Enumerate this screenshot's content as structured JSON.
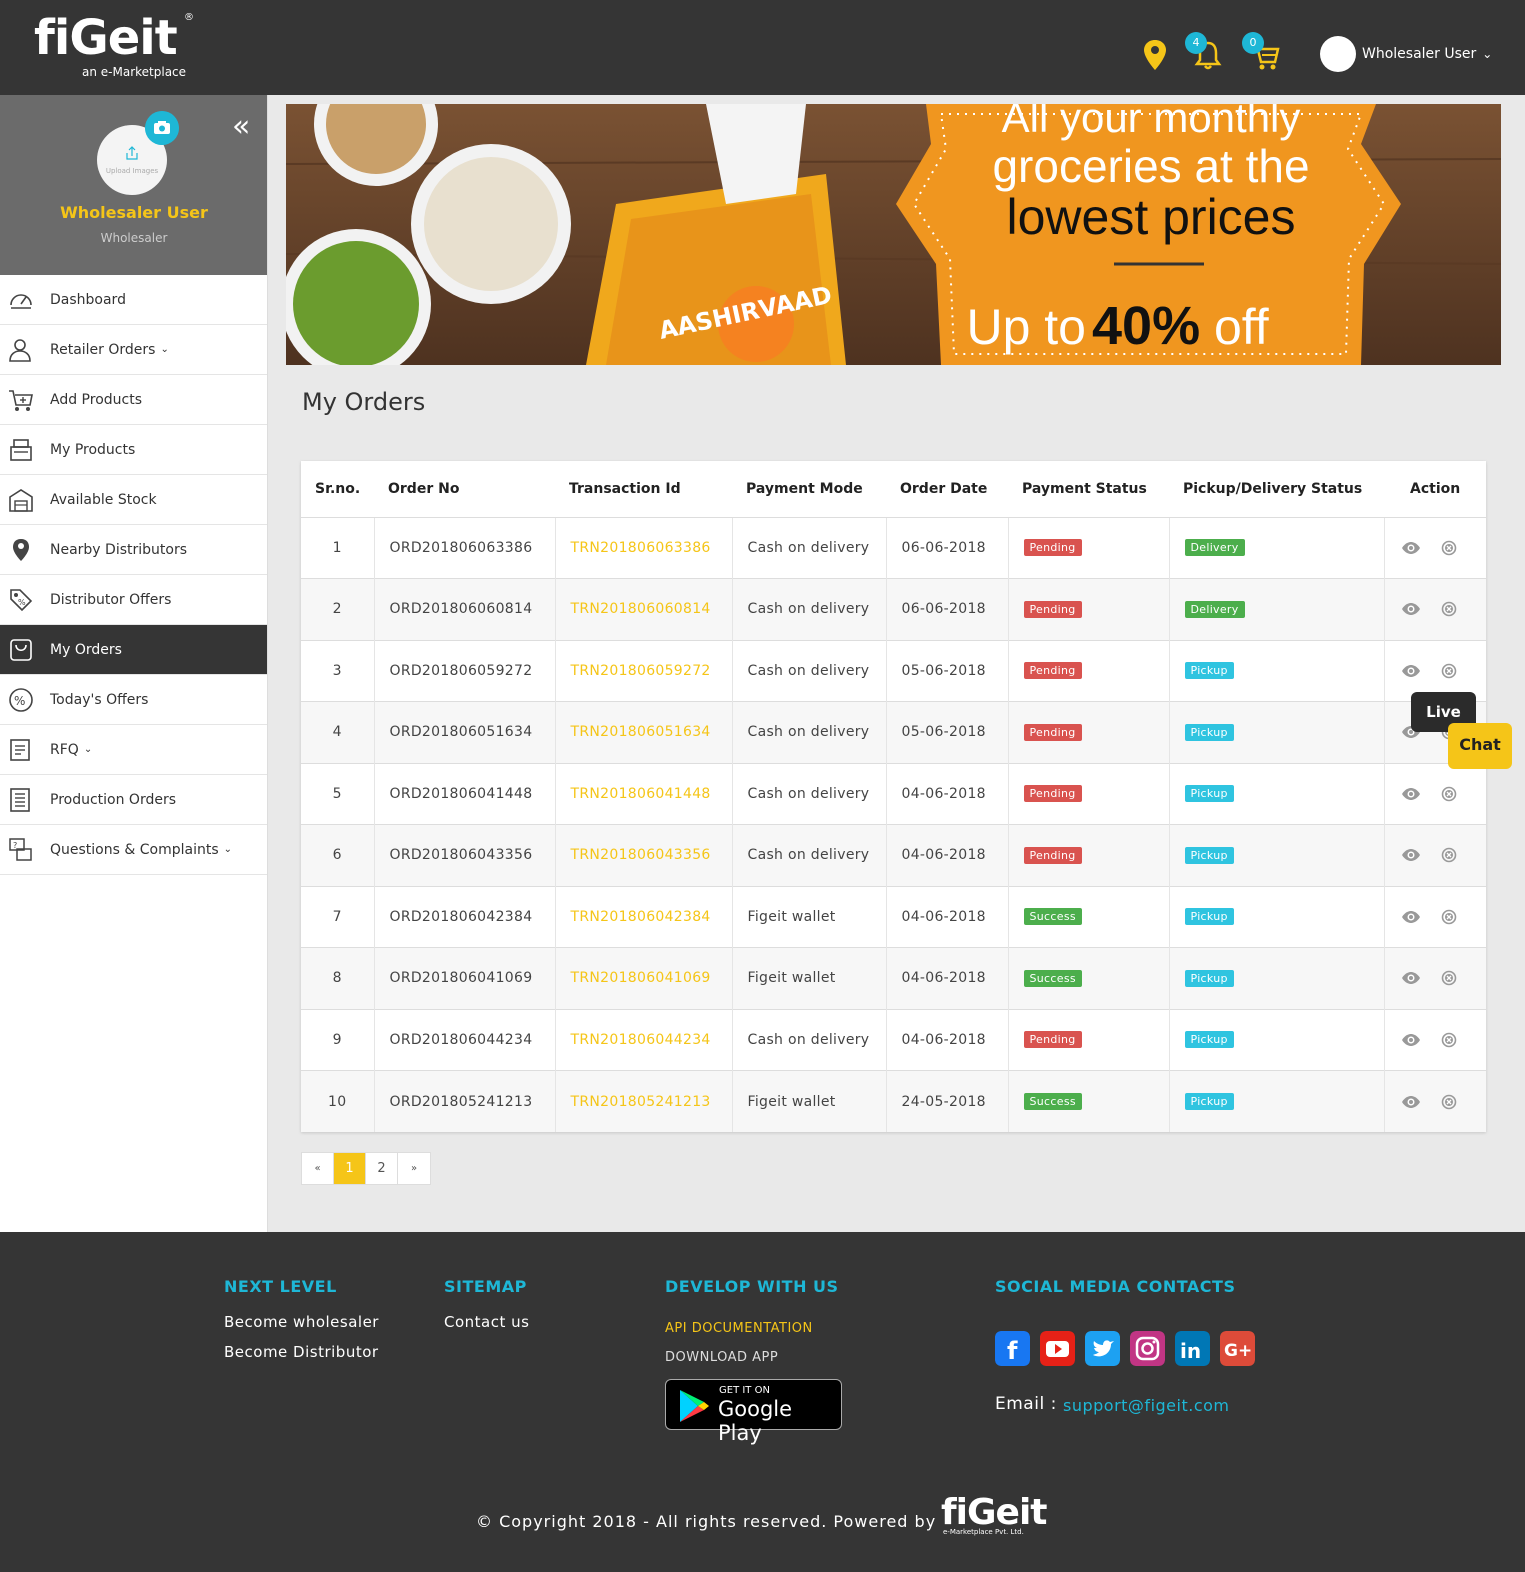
{
  "header": {
    "brand": "fiGeit",
    "registered": "®",
    "tagline": "an e-Marketplace",
    "notifications_count": "4",
    "cart_count": "0",
    "user_name": "Wholesaler User"
  },
  "sidebar": {
    "upload_label": "Upload Images",
    "profile_name": "Wholesaler User",
    "profile_role": "Wholesaler",
    "items": [
      {
        "label": "Dashboard",
        "icon": "dashboard-icon"
      },
      {
        "label": "Retailer Orders",
        "icon": "user-icon",
        "has_dropdown": true
      },
      {
        "label": "Add Products",
        "icon": "cart-add-icon"
      },
      {
        "label": "My Products",
        "icon": "register-icon"
      },
      {
        "label": "Available Stock",
        "icon": "warehouse-icon"
      },
      {
        "label": "Nearby Distributors",
        "icon": "location-person-icon"
      },
      {
        "label": "Distributor Offers",
        "icon": "tags-icon"
      },
      {
        "label": "My Orders",
        "icon": "bag-icon",
        "active": true
      },
      {
        "label": "Today's Offers",
        "icon": "percent-icon"
      },
      {
        "label": "RFQ",
        "icon": "document-icon",
        "has_dropdown": true
      },
      {
        "label": "Production Orders",
        "icon": "list-icon"
      },
      {
        "label": "Questions & Complaints",
        "icon": "questions-icon",
        "has_dropdown": true
      }
    ]
  },
  "banner": {
    "line1": "All your monthly",
    "line2": "groceries at the",
    "line3": "lowest prices",
    "offer_prefix": "Up to",
    "offer_value": "40%",
    "offer_suffix": "off",
    "product_label": "AASHIRVAAD"
  },
  "main": {
    "title": "My Orders",
    "columns": [
      "Sr.no.",
      "Order No",
      "Transaction Id",
      "Payment Mode",
      "Order Date",
      "Payment Status",
      "Pickup/Delivery Status",
      "Action"
    ],
    "rows": [
      {
        "sr": "1",
        "order_no": "ORD201806063386",
        "txn": "TRN201806063386",
        "mode": "Cash on delivery",
        "date": "06-06-2018",
        "payment": "Pending",
        "delivery": "Delivery"
      },
      {
        "sr": "2",
        "order_no": "ORD201806060814",
        "txn": "TRN201806060814",
        "mode": "Cash on delivery",
        "date": "06-06-2018",
        "payment": "Pending",
        "delivery": "Delivery"
      },
      {
        "sr": "3",
        "order_no": "ORD201806059272",
        "txn": "TRN201806059272",
        "mode": "Cash on delivery",
        "date": "05-06-2018",
        "payment": "Pending",
        "delivery": "Pickup"
      },
      {
        "sr": "4",
        "order_no": "ORD201806051634",
        "txn": "TRN201806051634",
        "mode": "Cash on delivery",
        "date": "05-06-2018",
        "payment": "Pending",
        "delivery": "Pickup"
      },
      {
        "sr": "5",
        "order_no": "ORD201806041448",
        "txn": "TRN201806041448",
        "mode": "Cash on delivery",
        "date": "04-06-2018",
        "payment": "Pending",
        "delivery": "Pickup"
      },
      {
        "sr": "6",
        "order_no": "ORD201806043356",
        "txn": "TRN201806043356",
        "mode": "Cash on delivery",
        "date": "04-06-2018",
        "payment": "Pending",
        "delivery": "Pickup"
      },
      {
        "sr": "7",
        "order_no": "ORD201806042384",
        "txn": "TRN201806042384",
        "mode": "Figeit wallet",
        "date": "04-06-2018",
        "payment": "Success",
        "delivery": "Pickup"
      },
      {
        "sr": "8",
        "order_no": "ORD201806041069",
        "txn": "TRN201806041069",
        "mode": "Figeit wallet",
        "date": "04-06-2018",
        "payment": "Success",
        "delivery": "Pickup"
      },
      {
        "sr": "9",
        "order_no": "ORD201806044234",
        "txn": "TRN201806044234",
        "mode": "Cash on delivery",
        "date": "04-06-2018",
        "payment": "Pending",
        "delivery": "Pickup"
      },
      {
        "sr": "10",
        "order_no": "ORD201805241213",
        "txn": "TRN201805241213",
        "mode": "Figeit wallet",
        "date": "24-05-2018",
        "payment": "Success",
        "delivery": "Pickup"
      }
    ],
    "pagination": {
      "prev": "«",
      "pages": [
        "1",
        "2"
      ],
      "current": "1",
      "next": "»"
    }
  },
  "live_chat": {
    "live": "Live",
    "chat": "Chat"
  },
  "footer": {
    "next_level": {
      "title": "NEXT LEVEL",
      "links": [
        "Become wholesaler",
        "Become Distributor"
      ]
    },
    "sitemap": {
      "title": "SITEMAP",
      "links": [
        "Contact us"
      ]
    },
    "develop": {
      "title": "DEVELOP WITH US",
      "api": "API DOCUMENTATION",
      "download": "DOWNLOAD APP",
      "store_small": "GET IT ON",
      "store_big": "Google Play"
    },
    "social": {
      "title": "SOCIAL MEDIA CONTACTS",
      "icons": [
        "facebook-icon",
        "youtube-icon",
        "twitter-icon",
        "instagram-icon",
        "linkedin-icon",
        "google-plus-icon"
      ]
    },
    "email_label": "Email :",
    "email": "support@figeit.com",
    "copyright": "© Copyright 2018 - All rights reserved. Powered by",
    "logo": "fiGeit",
    "logo_sub": "e-Marketplace Pvt. Ltd."
  },
  "colors": {
    "accent": "#f5c518",
    "header_bg": "#353535",
    "cyan": "#1eb7d6",
    "pending": "#d9534f",
    "success": "#4cae4c",
    "pickup": "#2fc4e0"
  }
}
